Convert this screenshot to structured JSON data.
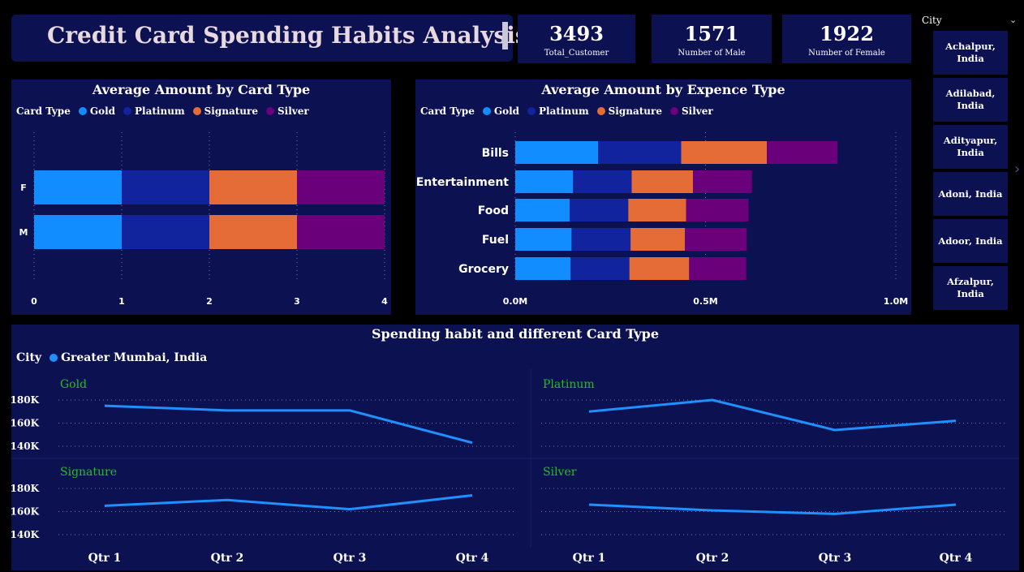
{
  "header": {
    "title": "Credit Card Spending Habits Analysis"
  },
  "kpis": [
    {
      "value": "3493",
      "label": "Total_Customer"
    },
    {
      "value": "1571",
      "label": "Number of Male"
    },
    {
      "value": "1922",
      "label": "Number of Female"
    }
  ],
  "city_slicer": {
    "label": "City",
    "items": [
      "Achalpur, India",
      "Adilabad, India",
      "Adityapur, India",
      "Adoni, India",
      "Adoor, India",
      "Afzalpur, India"
    ]
  },
  "colors": {
    "Gold": "#118dff",
    "Platinum": "#12239e",
    "Signature": "#e66c37",
    "Silver": "#6b007b",
    "line": "#1e90ff",
    "panel": "#0c1152",
    "small_multiple_title": "#1fc11f"
  },
  "legend_label": "Card Type",
  "legend_items": [
    "Gold",
    "Platinum",
    "Signature",
    "Silver"
  ],
  "bottom_legend": {
    "label": "City",
    "item": "Greater Mumbai, India"
  },
  "chart_data": [
    {
      "type": "bar",
      "orientation": "horizontal",
      "stacked": true,
      "title": "Average Amount by Card Type",
      "categories": [
        "F",
        "M"
      ],
      "series": [
        {
          "name": "Gold",
          "values": [
            1,
            1
          ]
        },
        {
          "name": "Platinum",
          "values": [
            1,
            1
          ]
        },
        {
          "name": "Signature",
          "values": [
            1,
            1
          ]
        },
        {
          "name": "Silver",
          "values": [
            1,
            1
          ]
        }
      ],
      "xlim": [
        0,
        4
      ],
      "xticks": [
        "0",
        "1",
        "2",
        "3",
        "4"
      ],
      "grid": true,
      "legend_position": "top-left"
    },
    {
      "type": "bar",
      "orientation": "horizontal",
      "stacked": true,
      "title": "Average Amount by Expence Type",
      "categories": [
        "Bills",
        "Entertainment",
        "Food",
        "Fuel",
        "Grocery"
      ],
      "series": [
        {
          "name": "Gold",
          "values": [
            218000,
            152000,
            143000,
            148000,
            145000
          ]
        },
        {
          "name": "Platinum",
          "values": [
            218000,
            154000,
            154000,
            155000,
            155000
          ]
        },
        {
          "name": "Signature",
          "values": [
            225000,
            161000,
            152000,
            143000,
            157000
          ]
        },
        {
          "name": "Silver",
          "values": [
            186000,
            155000,
            164000,
            162000,
            150000
          ]
        }
      ],
      "xlim": [
        0,
        1000000
      ],
      "xticks": [
        "0.0M",
        "0.5M",
        "1.0M"
      ],
      "grid": true,
      "legend_position": "top-left"
    },
    {
      "type": "line",
      "title": "Spending habit and different Card Type",
      "x": [
        "Qtr 1",
        "Qtr 2",
        "Qtr 3",
        "Qtr 4"
      ],
      "yticks": [
        "180K",
        "160K",
        "140K"
      ],
      "ylim": [
        135000,
        185000
      ],
      "series_name": "Greater Mumbai, India",
      "panels": [
        {
          "name": "Gold",
          "values": [
            175000,
            171000,
            171000,
            143000
          ]
        },
        {
          "name": "Platinum",
          "values": [
            170000,
            180000,
            154000,
            162000
          ]
        },
        {
          "name": "Signature",
          "values": [
            165000,
            170000,
            162000,
            174000
          ]
        },
        {
          "name": "Silver",
          "values": [
            166000,
            161000,
            158000,
            166000
          ]
        }
      ]
    }
  ]
}
